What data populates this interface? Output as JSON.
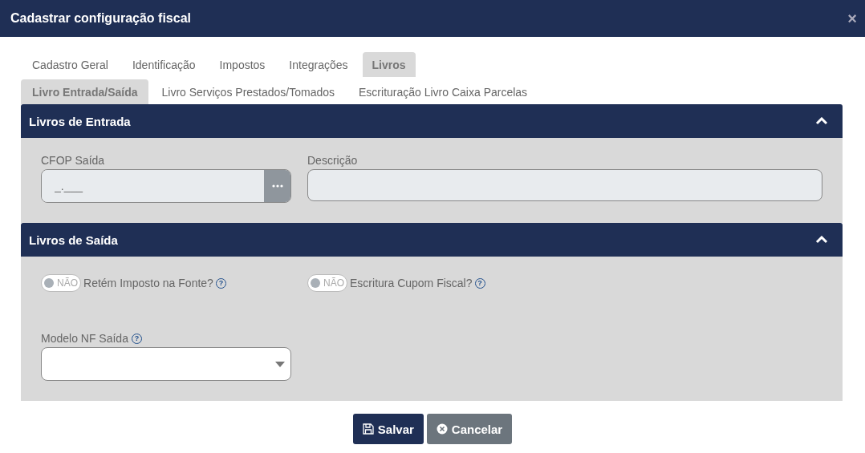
{
  "window": {
    "title": "Cadastrar configuração fiscal",
    "close": "×"
  },
  "tabs": [
    {
      "label": "Cadastro Geral",
      "selected": false
    },
    {
      "label": "Identificação",
      "selected": false
    },
    {
      "label": "Impostos",
      "selected": false
    },
    {
      "label": "Integrações",
      "selected": false
    },
    {
      "label": "Livros",
      "selected": true
    }
  ],
  "subtabs": [
    {
      "label": "Livro Entrada/Saída",
      "selected": true
    },
    {
      "label": "Livro Serviços Prestados/Tomados",
      "selected": false
    },
    {
      "label": "Escrituração Livro Caixa Parcelas",
      "selected": false
    }
  ],
  "sections": [
    {
      "title": "Livros de Entrada",
      "expanded": true,
      "fields": [
        {
          "kind": "lookup",
          "label": "CFOP Saída",
          "placeholder": "_.___"
        },
        {
          "kind": "text",
          "label": "Descrição"
        }
      ]
    },
    {
      "title": "Livros de Saída",
      "expanded": true,
      "fields": [
        {
          "kind": "toggle",
          "on": false,
          "state_label": "NÃO",
          "label": "Retém Imposto na Fonte?",
          "help": "?"
        },
        {
          "kind": "toggle",
          "on": false,
          "state_label": "NÃO",
          "label": "Escritura Cupom Fiscal?",
          "help": "?"
        },
        {
          "kind": "select",
          "label": "Modelo NF Saída",
          "help": "?"
        }
      ]
    }
  ],
  "buttons": [
    {
      "kind": "primary",
      "label": "Salvar"
    },
    {
      "kind": "secondary",
      "label": "Cancelar"
    }
  ]
}
